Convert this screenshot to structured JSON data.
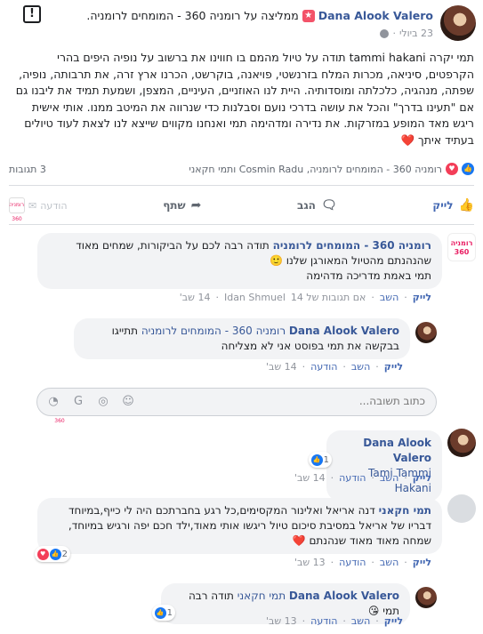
{
  "post": {
    "author": "Dana Alook Valero",
    "action_text": "ממליצה על רומניה 360 - המומחים לרומניה.",
    "date": "23 ביולי",
    "body": "תמי יקרה tammi hakani תודה על טיול מהמם בו חווינו את ברשוב על נופיה היפים בהרי הקרפטים, סיניאה, מכרות המלח בזרנשטי, פויאנה, בוקרשט, הכרנו ארץ זרה, את תרבותה, נופיה, שפתה, מנהגיה, כלכלתה ומוסדותיה. היית לנו האוזניים, העיניים, המצפן, ושמעת תמיד את ליבנו גם אם \"תעינו בדרך\" והכל את עושה בדרכי נועם וסבלנות כדי שנרווה את המיטב ממנו. אותי אישית ריגש מאד המופע במזרקות. את נדירה ומדהימה תמי ואנחנו מקווים שייצא לנו לצאת לעוד טיולים בעתיד איתך",
    "heart": "❤️"
  },
  "reactions": {
    "names": "רומניה 360 - המומחים לרומניה, Cosmin Radu ותמי חקאני",
    "comments_count": "3 תגובות"
  },
  "actions": {
    "like": "לייק",
    "comment": "הגב",
    "share": "שתף",
    "send": "הודעה"
  },
  "comments": [
    {
      "author": "רומניה 360 - המומחים לרומניה",
      "text": "תודה רבה לכם על הביקורות, שמחים מאוד שהנהנתם מהטיול המאורגן שלנו 🙂",
      "text2": "תמי באמת מדריכה מדהימה",
      "like": "לייק",
      "reply": "השב",
      "replies": "אם תגובות של 14",
      "seen": "Idan Shmuel",
      "time": "14 שב'"
    },
    {
      "author": "Dana Alook Valero",
      "tag": "רומניה 360 - המומחים לרומניה",
      "text": "תתייגו בבקשה את תמי בפוסט אני לא מצליחה",
      "like": "לייק",
      "reply": "השב",
      "send": "הודעה",
      "time": "14 שב'"
    },
    {
      "author": "Dana Alook Valero",
      "tag": "Tammi Hakani",
      "tag_prefix": "Tami",
      "like": "לייק",
      "reply": "השב",
      "send": "הודעה",
      "time": "14 שב'",
      "react_count": "1"
    },
    {
      "author": "תמי חקאני",
      "text": "דנה אריאל ואלינור המקסימים,כל רגע בחברתכם היה לי כייף,במיוחד דבריו של אריאל במסיבת סיכום טיול ריגשו אותי מאוד,ילד חכם יפה ורגיש במיוחד, שמחה מאוד מאוד שנהנתם",
      "heart": "❤️",
      "like": "לייק",
      "reply": "השב",
      "send": "הודעה",
      "time": "13 שב'",
      "react_count": "2"
    },
    {
      "author": "Dana Alook Valero",
      "tag": "תמי חקאני",
      "text": "תודה רבה תמי",
      "emoji": "😘",
      "like": "לייק",
      "reply": "השב",
      "send": "הודעה",
      "time": "13 שב'",
      "react_count": "1"
    }
  ],
  "reply_box": {
    "placeholder": "כתוב תשובה..."
  },
  "page_logo_text": "רומניה 360",
  "colors": {
    "link": "#385898",
    "like_blue": "#4267b2",
    "bubble": "#f2f3f5"
  }
}
